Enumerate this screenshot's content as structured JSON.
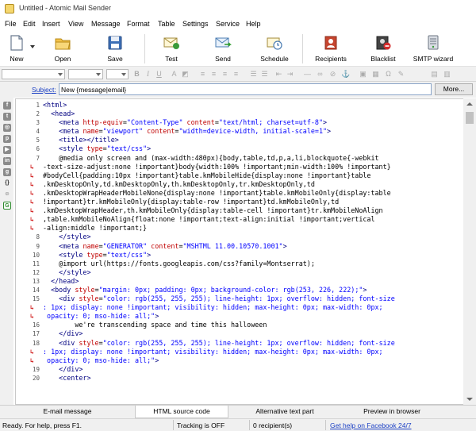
{
  "window": {
    "title": "Untitled - Atomic Mail Sender"
  },
  "menu": [
    "File",
    "Edit",
    "Insert",
    "View",
    "Message",
    "Format",
    "Table",
    "Settings",
    "Service",
    "Help"
  ],
  "toolbar": {
    "new": "New",
    "open": "Open",
    "save": "Save",
    "test": "Test",
    "send": "Send",
    "schedule": "Schedule",
    "recipients": "Recipients",
    "blacklist": "Blacklist",
    "smtp_wizard": "SMTP wizard"
  },
  "subject": {
    "label": "Subject:",
    "value": "New {message|email}",
    "more_button": "More..."
  },
  "editor": {
    "lines": [
      {
        "n": "1",
        "w": false,
        "html": "<span class='tag'>&lt;html&gt;</span>"
      },
      {
        "n": "2",
        "w": false,
        "html": "  <span class='tag'>&lt;head&gt;</span>"
      },
      {
        "n": "3",
        "w": false,
        "html": "    <span class='tag'>&lt;meta</span> <span class='attr'>http-equiv</span>=<span class='val'>\"Content-Type\"</span> <span class='attr'>content</span>=<span class='val'>\"text/html; charset=utf-8\"</span><span class='tag'>&gt;</span>"
      },
      {
        "n": "4",
        "w": false,
        "html": "    <span class='tag'>&lt;meta</span> <span class='attr'>name</span>=<span class='val'>\"viewport\"</span> <span class='attr'>content</span>=<span class='val'>\"width=device-width, initial-scale=1\"</span><span class='tag'>&gt;</span>"
      },
      {
        "n": "5",
        "w": false,
        "html": "    <span class='tag'>&lt;title&gt;&lt;/title&gt;</span>"
      },
      {
        "n": "6",
        "w": false,
        "html": "    <span class='tag'>&lt;style</span> <span class='attr'>type</span>=<span class='val'>\"text/css\"</span><span class='tag'>&gt;</span>"
      },
      {
        "n": "7",
        "w": false,
        "html": "    @media only screen and (max-width:480px){body,table,td,p,a,li,blockquote{-webkit"
      },
      {
        "n": "",
        "w": true,
        "html": "-text-size-adjust:none !important}body{width:100% !important;min-width:100% !important}"
      },
      {
        "n": "",
        "w": true,
        "html": "#bodyCell{padding:10px !important}table.kmMobileHide{display:none !important}table"
      },
      {
        "n": "",
        "w": true,
        "html": ".kmDesktopOnly,td.kmDesktopOnly,th.kmDesktopOnly,tr.kmDesktopOnly,td"
      },
      {
        "n": "",
        "w": true,
        "html": ".kmDesktopWrapHeaderMobileNone{display:none !important}table.kmMobileOnly{display:table"
      },
      {
        "n": "",
        "w": true,
        "html": "!important}tr.kmMobileOnly{display:table-row !important}td.kmMobileOnly,td"
      },
      {
        "n": "",
        "w": true,
        "html": ".kmDesktopWrapHeader,th.kmMobileOnly{display:table-cell !important}tr.kmMobileNoAlign"
      },
      {
        "n": "",
        "w": true,
        "html": ",table.kmMobileNoAlign{float:none !important;text-align:initial !important;vertical"
      },
      {
        "n": "",
        "w": true,
        "html": "-align:middle !important;}"
      },
      {
        "n": "8",
        "w": false,
        "html": "    <span class='tag'>&lt;/style&gt;</span>"
      },
      {
        "n": "9",
        "w": false,
        "html": "    <span class='tag'>&lt;meta</span> <span class='attr'>name</span>=<span class='val'>\"GENERATOR\"</span> <span class='attr'>content</span>=<span class='val'>\"MSHTML 11.00.10570.1001\"</span><span class='tag'>&gt;</span>"
      },
      {
        "n": "10",
        "w": false,
        "html": "    <span class='tag'>&lt;style</span> <span class='attr'>type</span>=<span class='val'>\"text/css\"</span><span class='tag'>&gt;</span>"
      },
      {
        "n": "11",
        "w": false,
        "html": "    @import url(https://fonts.googleapis.com/css?family=Montserrat);"
      },
      {
        "n": "12",
        "w": false,
        "html": "    <span class='tag'>&lt;/style&gt;</span>"
      },
      {
        "n": "13",
        "w": false,
        "html": "  <span class='tag'>&lt;/head&gt;</span>"
      },
      {
        "n": "14",
        "w": false,
        "html": "  <span class='tag'>&lt;body</span> <span class='attr'>style</span>=<span class='val'>\"margin: 0px; padding: 0px; background-color: rgb(253, 226, 222);\"</span><span class='tag'>&gt;</span>"
      },
      {
        "n": "15",
        "w": false,
        "html": "    <span class='tag'>&lt;div</span> <span class='attr'>style</span>=<span class='val'>\"color: rgb(255, 255, 255); line-height: 1px; overflow: hidden; font-size</span>"
      },
      {
        "n": "",
        "w": true,
        "html": "<span class='val'>: 1px; display: none !important; visibility: hidden; max-height: 0px; max-width: 0px;</span>"
      },
      {
        "n": "",
        "w": true,
        "html": "<span class='val'> opacity: 0; mso-hide: all;\"</span><span class='tag'>&gt;</span>"
      },
      {
        "n": "16",
        "w": false,
        "html": "        we're transcending space and time this halloween"
      },
      {
        "n": "17",
        "w": false,
        "html": "    <span class='tag'>&lt;/div&gt;</span>"
      },
      {
        "n": "18",
        "w": false,
        "html": "    <span class='tag'>&lt;div</span> <span class='attr'>style</span>=<span class='val'>\"color: rgb(255, 255, 255); line-height: 1px; overflow: hidden; font-size</span>"
      },
      {
        "n": "",
        "w": true,
        "html": "<span class='val'>: 1px; display: none !important; visibility: hidden; max-height: 0px; max-width: 0px;</span>"
      },
      {
        "n": "",
        "w": true,
        "html": "<span class='val'> opacity: 0; mso-hide: all;\"</span><span class='tag'>&gt;</span>"
      },
      {
        "n": "19",
        "w": false,
        "html": "    <span class='tag'>&lt;/div&gt;</span>"
      },
      {
        "n": "20",
        "w": false,
        "html": "    <span class='tag'>&lt;center&gt;</span>"
      }
    ]
  },
  "tabs": [
    "E-mail message",
    "HTML source code",
    "Alternative text part",
    "Preview in browser"
  ],
  "status": {
    "ready": "Ready. For help, press F1.",
    "tracking": "Tracking is OFF",
    "recipients": "0 recipient(s)",
    "facebook": "Get help on Facebook 24/7"
  },
  "colors": {
    "tag": "#000080",
    "attr": "#c00000",
    "value": "#0000ff",
    "link": "#1a3fc4",
    "wrap_mark": "#d12020"
  }
}
